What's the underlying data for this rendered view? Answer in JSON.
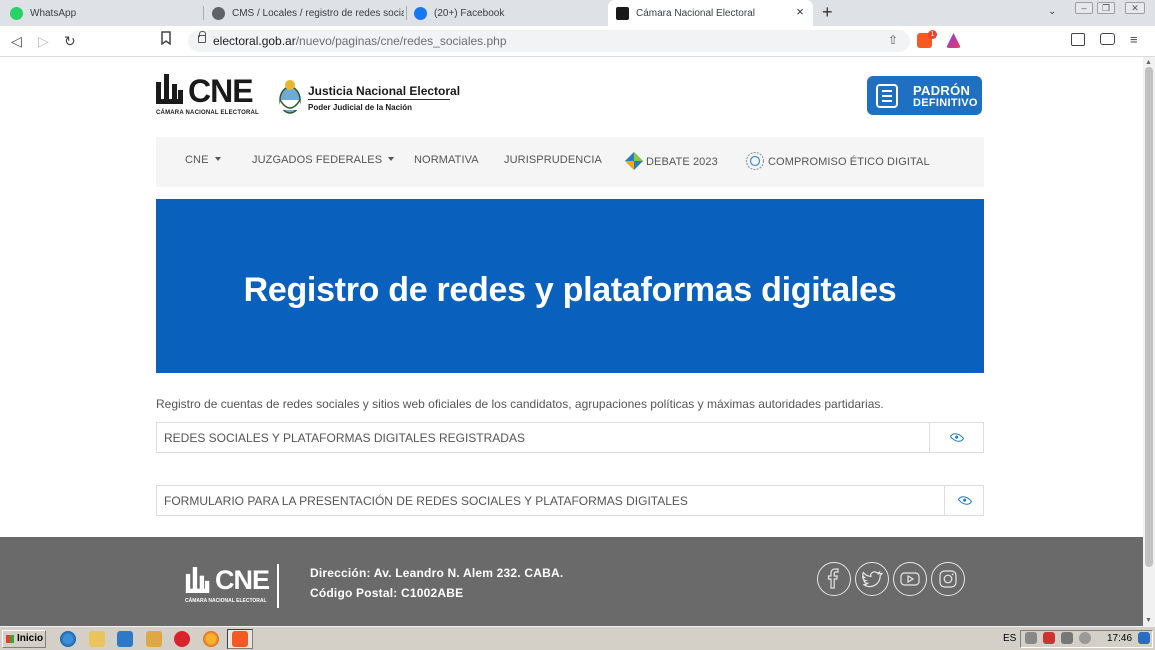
{
  "browser": {
    "tabs": [
      {
        "title": "WhatsApp",
        "icon": "whatsapp-icon"
      },
      {
        "title": "CMS / Locales / registro de redes sociales",
        "icon": "globe-icon"
      },
      {
        "title": "(20+) Facebook",
        "icon": "facebook-icon"
      },
      {
        "title": "Cámara Nacional Electoral",
        "icon": "cne-favicon",
        "active": true
      }
    ],
    "tab_close": "×",
    "new_tab": "+",
    "tab_list": "⌄",
    "window_controls": [
      "–",
      "❐",
      "✕"
    ],
    "back": "◁",
    "forward": "▷",
    "reload": "↻",
    "url_domain": "electoral.gob.ar",
    "url_path": "/nuevo/paginas/cne/redes_sociales.php",
    "share": "⇧",
    "extension_badge_count": "1"
  },
  "header": {
    "cne_logo": "CNE",
    "cne_subtitle": "CÁMARA NACIONAL ELECTORAL",
    "jne_title": "Justicia Nacional Electoral",
    "jne_subtitle": "Poder Judicial de la Nación",
    "padron_line1": "PADRÓN",
    "padron_line2": "DEFINITIVO"
  },
  "nav": {
    "items": [
      {
        "label": "CNE",
        "dropdown": true
      },
      {
        "label": "JUZGADOS FEDERALES",
        "dropdown": true
      },
      {
        "label": "NORMATIVA"
      },
      {
        "label": "JURISPRUDENCIA"
      },
      {
        "label": "DEBATE 2023",
        "icon": "debate-diamond-icon"
      },
      {
        "label": "COMPROMISO ÉTICO DIGITAL",
        "icon": "compromiso-seal-icon"
      }
    ]
  },
  "hero": {
    "title": "Registro de redes y plataformas digitales",
    "background": "#0a61bd"
  },
  "content": {
    "intro": "Registro de cuentas de redes sociales y sitios web oficiales de los candidatos, agrupaciones políticas y máximas autoridades partidarias.",
    "accordions": [
      {
        "label": "REDES SOCIALES Y PLATAFORMAS DIGITALES REGISTRADAS",
        "icon": "eye-icon"
      },
      {
        "label": "FORMULARIO PARA LA PRESENTACIÓN DE REDES SOCIALES Y PLATAFORMAS DIGITALES",
        "icon": "eye-icon"
      }
    ]
  },
  "footer": {
    "logo": "CNE",
    "logo_subtitle": "CÁMARA NACIONAL ELECTORAL",
    "direccion": "Dirección: Av. Leandro N. Alem 232. CABA.",
    "codigo_postal": "Código Postal: C1002ABE",
    "social": [
      "facebook-icon",
      "twitter-icon",
      "youtube-icon",
      "instagram-icon"
    ],
    "background": "#6a6a6a"
  },
  "taskbar": {
    "start_label": "Inicio",
    "language": "ES",
    "clock": "17:46"
  },
  "colors": {
    "brand_blue": "#1f70c1",
    "accent_eye": "#1e7bb8"
  }
}
